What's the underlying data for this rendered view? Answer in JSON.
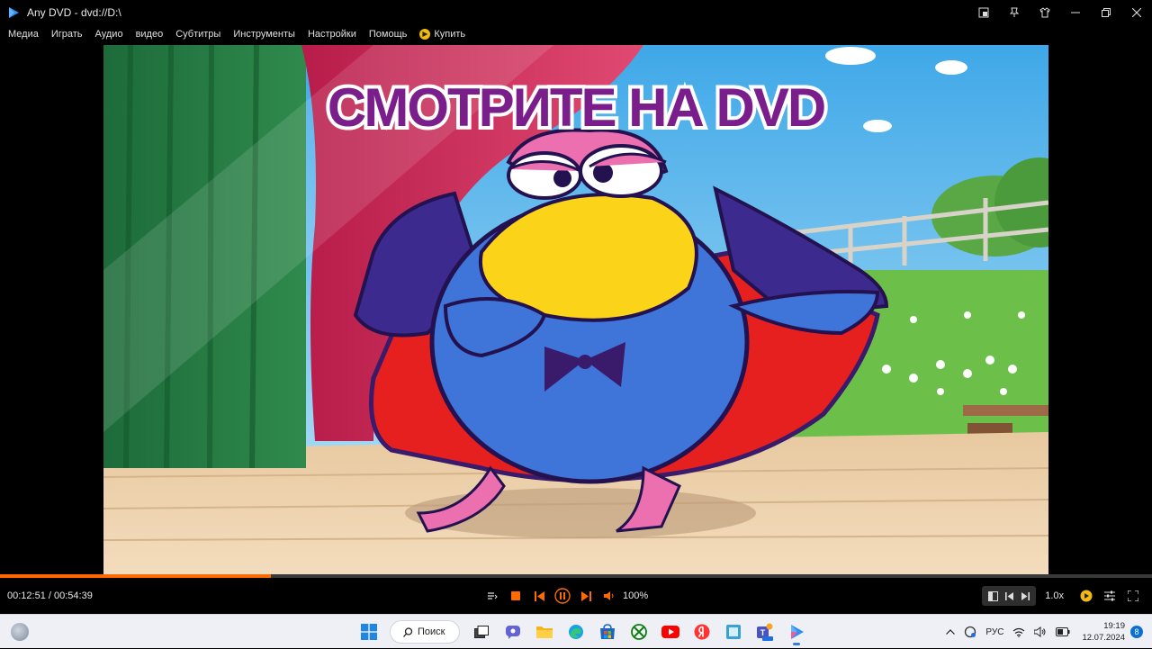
{
  "window": {
    "app_name": "Any DVD",
    "title": "Any DVD  -  dvd://D:\\"
  },
  "title_controls": [
    "pin-window-icon",
    "pin-icon",
    "shirt-icon",
    "minimize-icon",
    "restore-icon",
    "close-icon"
  ],
  "menu": {
    "items": [
      "Медиа",
      "Играть",
      "Аудио",
      "видео",
      "Субтитры",
      "Инструменты",
      "Настройки",
      "Помощь"
    ],
    "buy_label": "Купить"
  },
  "video": {
    "overlay_text": "СМОТРИТЕ НА DVD"
  },
  "playback": {
    "elapsed": "00:12:51",
    "total": "00:54:39",
    "time_text": "00:12:51 / 00:54:39",
    "progress_fraction": 0.235,
    "volume": "100%",
    "speed": "1.0x",
    "state": "playing"
  },
  "colors": {
    "accent": "#ff6a00",
    "background": "#000000",
    "taskbar": "#eef0f5"
  },
  "taskbar": {
    "search_label": "Поиск",
    "apps": [
      "start-icon",
      "search",
      "task-view-icon",
      "chat-icon",
      "file-explorer-icon",
      "edge-icon",
      "store-icon",
      "xbox-icon",
      "youtube-icon",
      "yandex-icon",
      "screenshot-icon",
      "teams-new-icon",
      "anydvd-icon"
    ],
    "tray": {
      "language": "РУС",
      "time": "19:19",
      "date": "12.07.2024",
      "notifications": "8"
    }
  }
}
